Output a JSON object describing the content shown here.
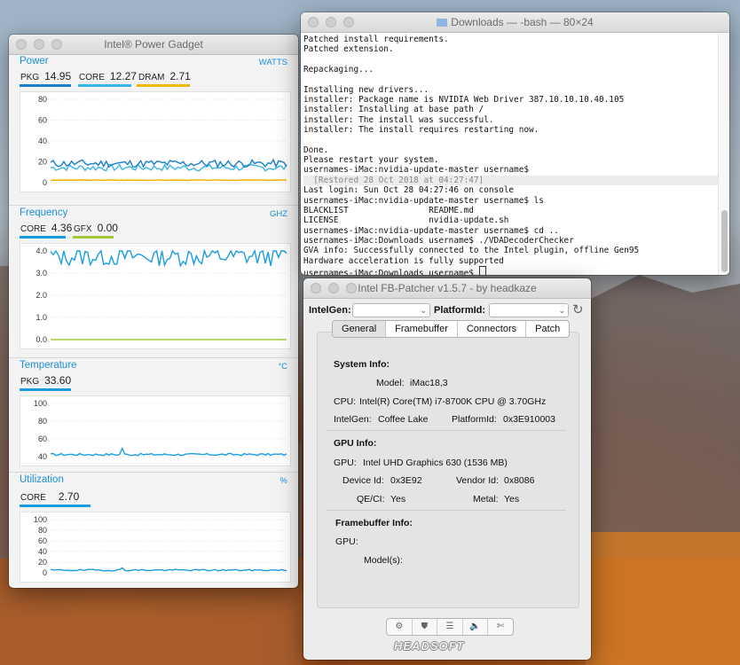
{
  "gadget": {
    "title": "Intel® Power Gadget",
    "power": {
      "heading": "Power",
      "unit": "WATTS",
      "stats": [
        {
          "label": "PKG",
          "value": "14.95",
          "color": "#1a7fc8"
        },
        {
          "label": "CORE",
          "value": "12.27",
          "color": "#39b4ea"
        },
        {
          "label": "DRAM",
          "value": "2.71",
          "color": "#f2b705"
        }
      ],
      "ticks": [
        "80",
        "60",
        "40",
        "20",
        "0"
      ]
    },
    "frequency": {
      "heading": "Frequency",
      "unit": "GHZ",
      "stats": [
        {
          "label": "CORE",
          "value": "4.36",
          "color": "#1a9de0"
        },
        {
          "label": "GFX",
          "value": "0.00",
          "color": "#a3c93a"
        }
      ],
      "ticks": [
        "4.0",
        "3.0",
        "2.0",
        "1.0",
        "0.0"
      ]
    },
    "temperature": {
      "heading": "Temperature",
      "unit": "°C",
      "stats": [
        {
          "label": "PKG",
          "value": "33.60",
          "color": "#1a9de0"
        }
      ],
      "ticks": [
        "100",
        "80",
        "60",
        "40"
      ]
    },
    "utilization": {
      "heading": "Utilization",
      "unit": "%",
      "stats": [
        {
          "label": "CORE",
          "value": "2.70",
          "color": "#1a9de0"
        }
      ],
      "ticks": [
        "100",
        "80",
        "60",
        "40",
        "20",
        "0"
      ]
    }
  },
  "terminal": {
    "title": "Downloads — -bash — 80×24",
    "lines": [
      "Patched install requirements.",
      "Patched extension.",
      "",
      "Repackaging...",
      "",
      "Installing new drivers...",
      "installer: Package name is NVIDIA Web Driver 387.10.10.10.40.105",
      "installer: Installing at base path /",
      "installer: The install was successful.",
      "installer: The install requires restarting now.",
      "",
      "Done.",
      "Please restart your system.",
      "usernames-iMac:nvidia-update-master username$",
      "  [Restored 28 Oct 2018 at 04:27:47]",
      "Last login: Sun Oct 28 04:27:46 on console",
      "usernames-iMac:nvidia-update-master username$ ls",
      "BLACKLIST                README.md",
      "LICENSE                  nvidia-update.sh",
      "usernames-iMac:nvidia-update-master username$ cd ..",
      "usernames-iMac:Downloads username$ ./VDADecoderChecker",
      "GVA info: Successfully connected to the Intel plugin, offline Gen95",
      "Hardware acceleration is fully supported",
      "usernames-iMac:Downloads username$ "
    ]
  },
  "fbpatcher": {
    "title": "Intel FB-Patcher v1.5.7 - by headkaze",
    "intelgen_label": "IntelGen:",
    "platformid_label": "PlatformId:",
    "tabs": [
      "General",
      "Framebuffer",
      "Connectors",
      "Patch"
    ],
    "system_info_heading": "System Info:",
    "model_label": "Model:",
    "model_value": "iMac18,3",
    "cpu_label": "CPU:",
    "cpu_value": "Intel(R) Core(TM) i7-8700K CPU @ 3.70GHz",
    "intelgen_info_label": "IntelGen:",
    "intelgen_info_value": "Coffee Lake",
    "platformid_info_label": "PlatformId:",
    "platformid_info_value": "0x3E910003",
    "gpu_info_heading": "GPU Info:",
    "gpu_label": "GPU:",
    "gpu_value": "Intel UHD Graphics 630 (1536 MB)",
    "device_id_label": "Device Id:",
    "device_id_value": "0x3E92",
    "vendor_id_label": "Vendor Id:",
    "vendor_id_value": "0x8086",
    "qeci_label": "QE/CI:",
    "qeci_value": "Yes",
    "metal_label": "Metal:",
    "metal_value": "Yes",
    "fb_info_heading": "Framebuffer Info:",
    "fb_gpu_label": "GPU:",
    "fb_model_label": "Model(s):",
    "toolbar_icons": [
      "gear-icon",
      "shield-icon",
      "list-icon",
      "speaker-icon",
      "tools-icon"
    ],
    "logo": "HEADSOFT"
  }
}
